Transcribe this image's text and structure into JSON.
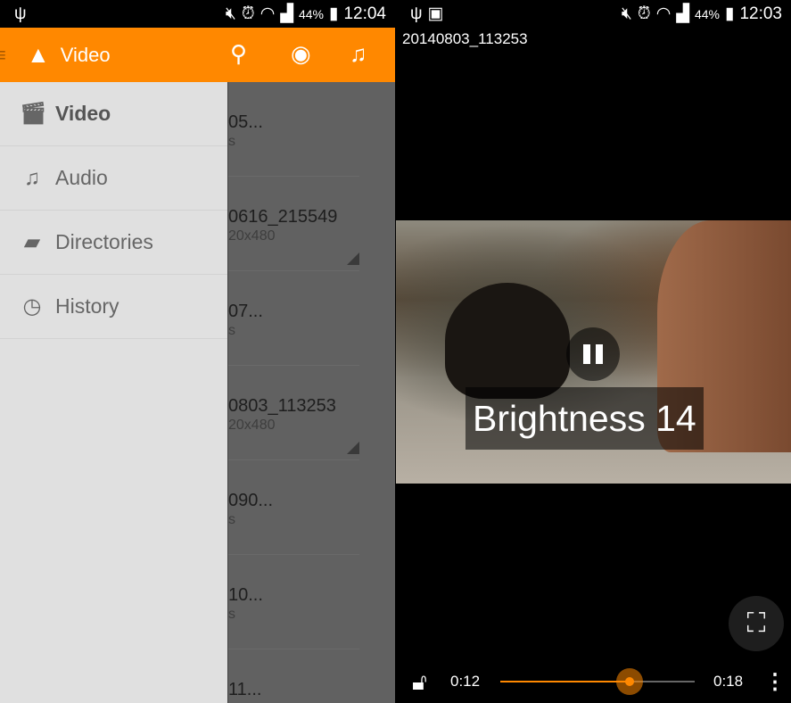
{
  "colors": {
    "accent": "#ff8800"
  },
  "left": {
    "status": {
      "battery": "44%",
      "time": "12:04"
    },
    "appbar": {
      "title": "Video",
      "icons": [
        "menu-icon",
        "vlc-cone-icon",
        "search-icon",
        "stream-icon",
        "playlist-repeat-icon"
      ]
    },
    "drawer": {
      "items": [
        {
          "label": "Video",
          "icon": "clapperboard-icon",
          "selected": true
        },
        {
          "label": "Audio",
          "icon": "music-note-icon"
        },
        {
          "label": "Directories",
          "icon": "folder-icon"
        },
        {
          "label": "History",
          "icon": "clock-icon"
        }
      ]
    },
    "list": [
      {
        "title": "05...",
        "sub": "s"
      },
      {
        "title": "0616_215549",
        "sub": "20x480"
      },
      {
        "title": "07...",
        "sub": "s"
      },
      {
        "title": "0803_113253",
        "sub": "20x480"
      },
      {
        "title": "090...",
        "sub": "s"
      },
      {
        "title": "10...",
        "sub": "s"
      },
      {
        "title": "11...",
        "sub": ""
      }
    ]
  },
  "right": {
    "status": {
      "battery": "44%",
      "time": "12:03"
    },
    "filename": "20140803_113253",
    "overlay": "Brightness 14",
    "player": {
      "current": "0:12",
      "total": "0:18",
      "progress": 0.667
    }
  }
}
